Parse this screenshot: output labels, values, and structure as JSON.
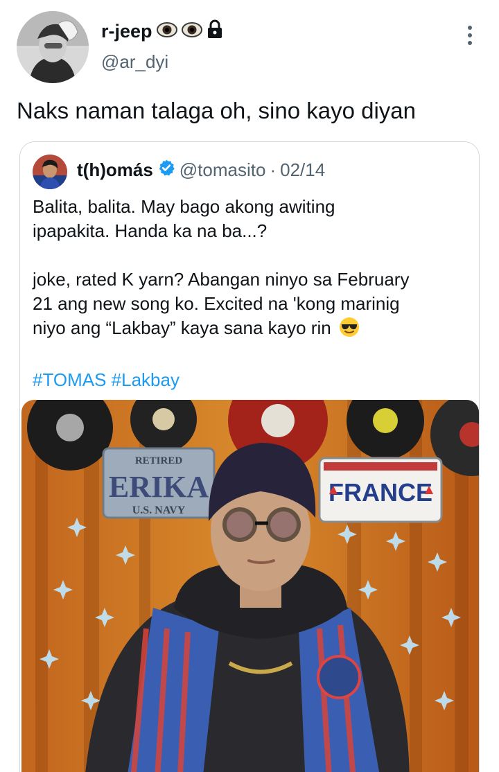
{
  "author": {
    "name": "r-jeep",
    "handle": "@ar_dyi",
    "name_icons": [
      "eye-icon",
      "eye-icon",
      "lock-icon"
    ]
  },
  "tweet": {
    "text": "Naks naman talaga oh, sino kayo diyan"
  },
  "quote": {
    "name": "t(h)omás",
    "verified": true,
    "handle": "@tomasito",
    "separator": "·",
    "date": "02/14",
    "line1": "Balita, balita. May bago akong awiting",
    "line2": "ipapakita. Handa ka na ba...?",
    "line3": "joke, rated K yarn? Abangan ninyo sa February",
    "line4": "21 ang new song ko. Excited na 'kong marinig",
    "line5": "niyo ang “Lakbay” kaya sana kayo rin",
    "emoji": "sunglasses-emoji",
    "hashtags": [
      "#TOMAS",
      "#Lakbay"
    ],
    "media": {
      "plate_left_top": "RETIRED",
      "plate_left_main": "ERIKA",
      "plate_left_bottom": "U.S. NAVY",
      "plate_right_main": "FRANCE"
    }
  },
  "colors": {
    "link": "#1d9bf0",
    "secondary_text": "#536471",
    "verified": "#1d9bf0",
    "border": "#cfd9de"
  }
}
